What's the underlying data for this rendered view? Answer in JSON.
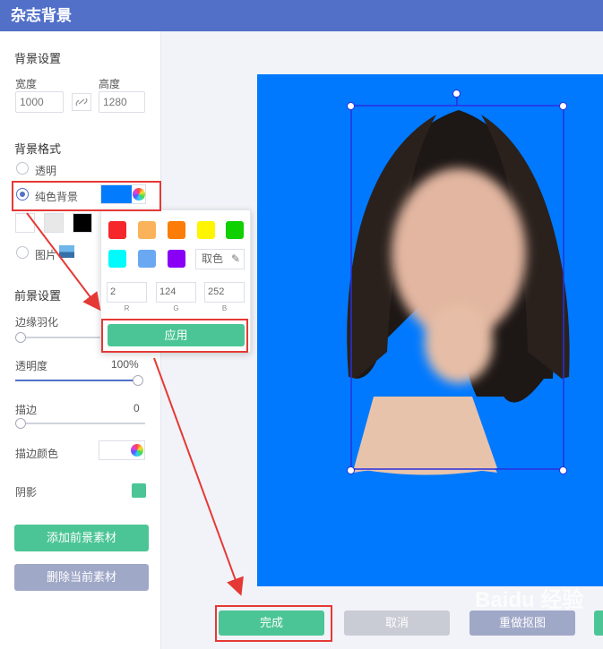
{
  "app": {
    "title": "杂志背景"
  },
  "background_settings": {
    "section_title": "背景设置",
    "width_label": "宽度",
    "width_value": "1000",
    "height_label": "高度",
    "height_value": "1280"
  },
  "background_format": {
    "section_title": "背景格式",
    "transparent_label": "透明",
    "solid_label": "纯色背景",
    "solid_color": "#027cfc",
    "image_label": "图片",
    "preset_colors": [
      "#ffffff",
      "#e8e8e8",
      "#000000"
    ]
  },
  "color_popup": {
    "colors": [
      "#f5272b",
      "#fbb35b",
      "#fb7d08",
      "#fff500",
      "#10d000",
      "#00fbfd",
      "#6ba8f2",
      "#8a00f7"
    ],
    "pick_label": "取色",
    "r_value": "2",
    "g_value": "124",
    "b_value": "252",
    "r_label": "R",
    "g_label": "G",
    "b_label": "B",
    "apply_label": "应用"
  },
  "foreground_settings": {
    "section_title": "前景设置",
    "feather_label": "边缘羽化",
    "opacity_label": "透明度",
    "opacity_value": "100%",
    "opacity_level": 1.0,
    "stroke_label": "描边",
    "stroke_value": "0",
    "stroke_color_label": "描边颜色",
    "shadow_label": "阴影",
    "shadow_color": "#4bc595"
  },
  "actions": {
    "add_foreground": "添加前景素材",
    "delete_current": "删除当前素材",
    "done": "完成",
    "cancel": "取消",
    "redo_crop": "重做抠图"
  },
  "watermark": {
    "text": "Baidu 经验"
  },
  "colors": {
    "accent": "#5270c8",
    "green": "#4bc595",
    "red_annotation": "#e53935",
    "photo_bg": "#0079ff"
  }
}
